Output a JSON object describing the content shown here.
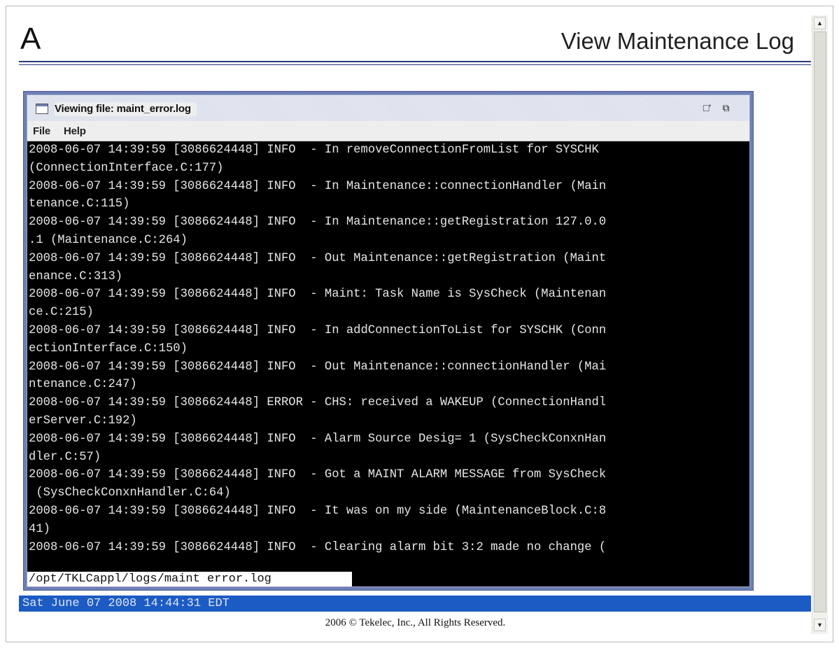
{
  "header": {
    "logo": "A",
    "title": "View Maintenance Log"
  },
  "window": {
    "title": "Viewing file: maint_error.log",
    "menu": [
      "File",
      "Help"
    ],
    "minimize_icon": "minimize-icon",
    "maximize_icon": "maximize-icon",
    "log_lines": [
      "2008-06-07 14:39:59 [3086624448] INFO  - In removeConnectionFromList for SYSCHK",
      "(ConnectionInterface.C:177)",
      "2008-06-07 14:39:59 [3086624448] INFO  - In Maintenance::connectionHandler (Main",
      "tenance.C:115)",
      "2008-06-07 14:39:59 [3086624448] INFO  - In Maintenance::getRegistration 127.0.0",
      ".1 (Maintenance.C:264)",
      "2008-06-07 14:39:59 [3086624448] INFO  - Out Maintenance::getRegistration (Maint",
      "enance.C:313)",
      "2008-06-07 14:39:59 [3086624448] INFO  - Maint: Task Name is SysCheck (Maintenan",
      "ce.C:215)",
      "2008-06-07 14:39:59 [3086624448] INFO  - In addConnectionToList for SYSCHK (Conn",
      "ectionInterface.C:150)",
      "2008-06-07 14:39:59 [3086624448] INFO  - Out Maintenance::connectionHandler (Mai",
      "ntenance.C:247)",
      "2008-06-07 14:39:59 [3086624448] ERROR - CHS: received a WAKEUP (ConnectionHandl",
      "erServer.C:192)",
      "2008-06-07 14:39:59 [3086624448] INFO  - Alarm Source Desig= 1 (SysCheckConxnHan",
      "dler.C:57)",
      "2008-06-07 14:39:59 [3086624448] INFO  - Got a MAINT ALARM MESSAGE from SysCheck",
      " (SysCheckConxnHandler.C:64)",
      "2008-06-07 14:39:59 [3086624448] INFO  - It was on my side (MaintenanceBlock.C:8",
      "41)",
      "2008-06-07 14:39:59 [3086624448] INFO  - Clearing alarm bit 3:2 made no change ("
    ],
    "path": "/opt/TKLCappl/logs/maint error.log"
  },
  "status": {
    "datetime": "Sat June 07 2008 14:44:31 EDT"
  },
  "footer": {
    "copyright": "2006 © Tekelec, Inc., All Rights Reserved."
  },
  "colors": {
    "status_bar": "#1c5bc3",
    "rule": "#2a3b7a",
    "window_border": "#6d7fb5",
    "log_bg": "#000000"
  }
}
